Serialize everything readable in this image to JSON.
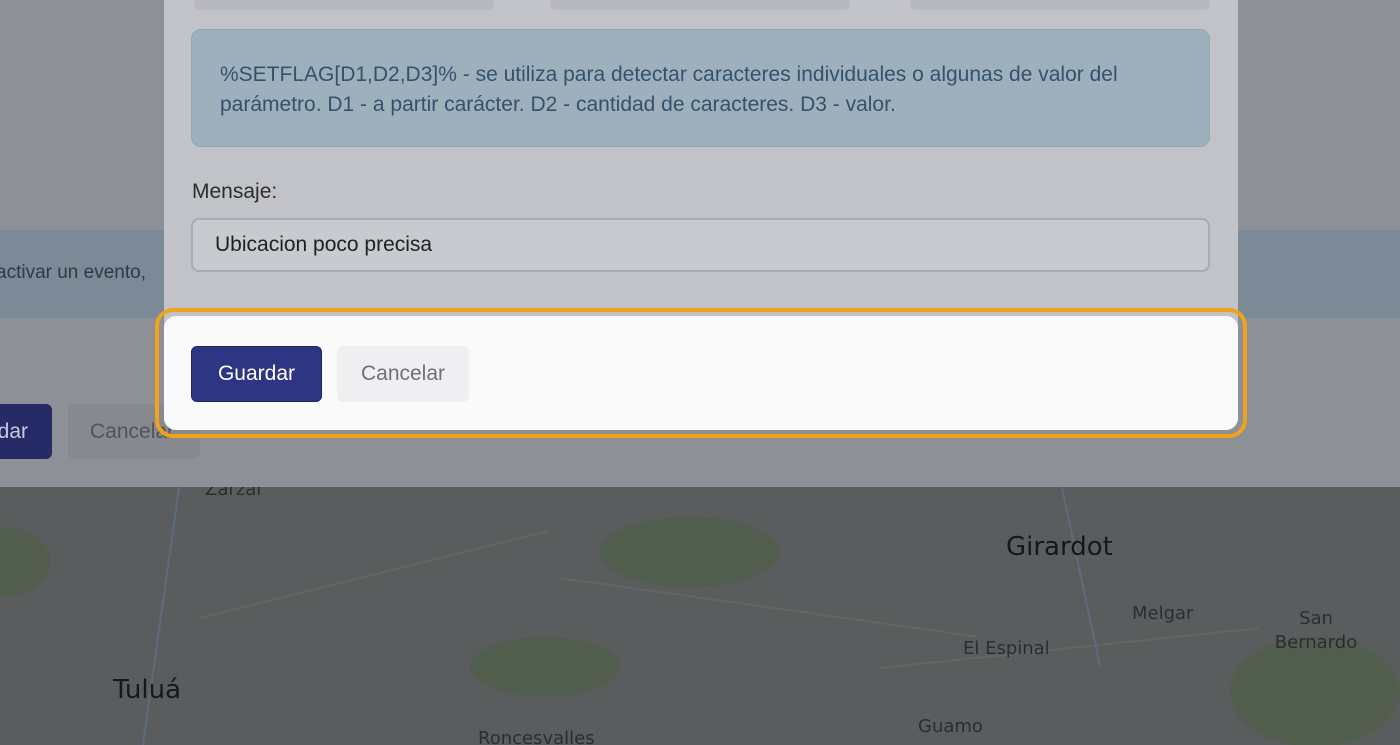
{
  "modal": {
    "info_text": "%SETFLAG[D1,D2,D3]% - se utiliza para detectar caracteres individuales o algunas de valor del parámetro. D1 - a partir carácter. D2 - cantidad de caracteres. D3 - valor.",
    "message_label": "Mensaje:",
    "message_value": "Ubicacion poco precisa",
    "save_label": "Guardar",
    "cancel_label": "Cancelar"
  },
  "background": {
    "alert_fragment": "activar un evento,",
    "save_fragment": "dar",
    "cancel_fragment": "Cancelar"
  },
  "map": {
    "cities": [
      "Zarzal",
      "Girardot",
      "Melgar",
      "San Bernardo",
      "El Espinal",
      "Tuluá",
      "Guamo",
      "Roncesvalles"
    ]
  },
  "colors": {
    "primary": "#2e3582",
    "highlight": "#f0a21a",
    "info_bg": "#9fb0bd"
  }
}
